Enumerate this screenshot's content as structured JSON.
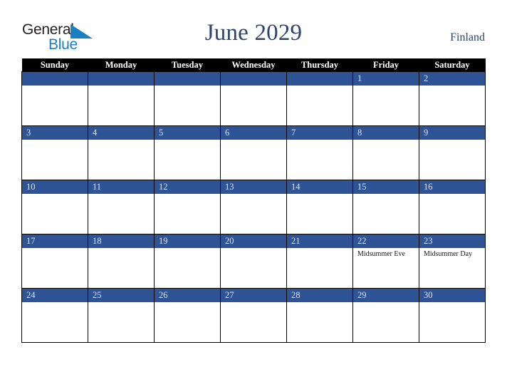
{
  "brand": {
    "name_line1": "General",
    "name_line2": "Blue",
    "triangle_icon": "blue-triangle-icon",
    "color_dark": "#231f20",
    "color_blue": "#1b7fc4"
  },
  "header": {
    "title": "June 2029",
    "country": "Finland",
    "title_color": "#2e4470"
  },
  "theme": {
    "band_blue": "#2f5496",
    "header_black": "#000000",
    "daynum_text": "#dbe3f0",
    "cell_background": "#ffffff",
    "grid_line": "#000000"
  },
  "calendar": {
    "month": "June",
    "year": "2029",
    "weekday_headers": [
      "Sunday",
      "Monday",
      "Tuesday",
      "Wednesday",
      "Thursday",
      "Friday",
      "Saturday"
    ],
    "weeks": [
      [
        {
          "day": "",
          "events": []
        },
        {
          "day": "",
          "events": []
        },
        {
          "day": "",
          "events": []
        },
        {
          "day": "",
          "events": []
        },
        {
          "day": "",
          "events": []
        },
        {
          "day": "1",
          "events": []
        },
        {
          "day": "2",
          "events": []
        }
      ],
      [
        {
          "day": "3",
          "events": []
        },
        {
          "day": "4",
          "events": []
        },
        {
          "day": "5",
          "events": []
        },
        {
          "day": "6",
          "events": []
        },
        {
          "day": "7",
          "events": []
        },
        {
          "day": "8",
          "events": []
        },
        {
          "day": "9",
          "events": []
        }
      ],
      [
        {
          "day": "10",
          "events": []
        },
        {
          "day": "11",
          "events": []
        },
        {
          "day": "12",
          "events": []
        },
        {
          "day": "13",
          "events": []
        },
        {
          "day": "14",
          "events": []
        },
        {
          "day": "15",
          "events": []
        },
        {
          "day": "16",
          "events": []
        }
      ],
      [
        {
          "day": "17",
          "events": []
        },
        {
          "day": "18",
          "events": []
        },
        {
          "day": "19",
          "events": []
        },
        {
          "day": "20",
          "events": []
        },
        {
          "day": "21",
          "events": []
        },
        {
          "day": "22",
          "events": [
            "Midsummer Eve"
          ]
        },
        {
          "day": "23",
          "events": [
            "Midsummer Day"
          ]
        }
      ],
      [
        {
          "day": "24",
          "events": []
        },
        {
          "day": "25",
          "events": []
        },
        {
          "day": "26",
          "events": []
        },
        {
          "day": "27",
          "events": []
        },
        {
          "day": "28",
          "events": []
        },
        {
          "day": "29",
          "events": []
        },
        {
          "day": "30",
          "events": []
        }
      ]
    ]
  }
}
